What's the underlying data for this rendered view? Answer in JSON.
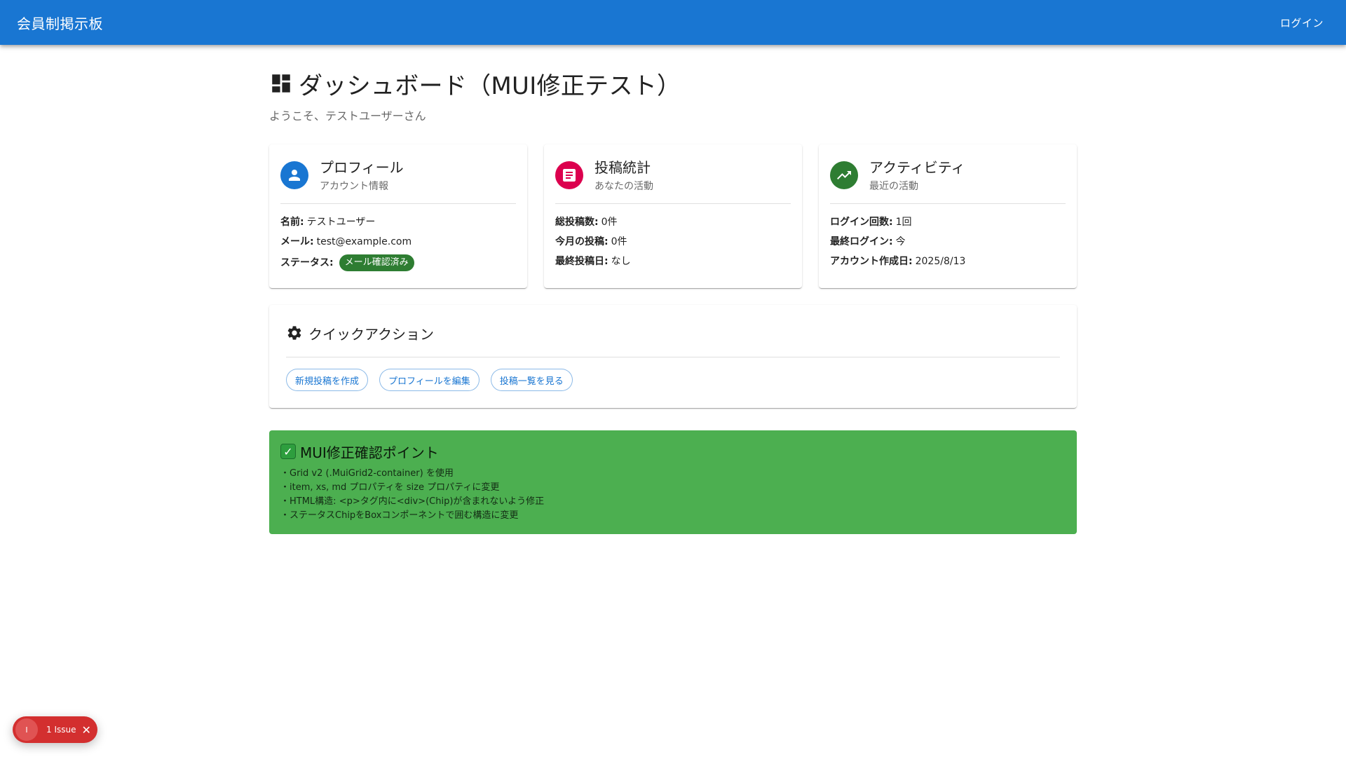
{
  "app": {
    "title": "会員制掲示板",
    "login_label": "ログイン"
  },
  "page": {
    "title": "ダッシュボード（MUI修正テスト）",
    "welcome": "ようこそ、テストユーザーさん"
  },
  "profile": {
    "title": "プロフィール",
    "subtitle": "アカウント情報",
    "name_label": "名前:",
    "name_value": "テストユーザー",
    "email_label": "メール:",
    "email_value": "test@example.com",
    "status_label": "ステータス:",
    "status_chip": "メール確認済み"
  },
  "stats": {
    "title": "投稿統計",
    "subtitle": "あなたの活動",
    "total_label": "総投稿数:",
    "total_value": "0件",
    "month_label": "今月の投稿:",
    "month_value": "0件",
    "last_label": "最終投稿日:",
    "last_value": "なし"
  },
  "activity": {
    "title": "アクティビティ",
    "subtitle": "最近の活動",
    "login_count_label": "ログイン回数:",
    "login_count_value": "1回",
    "last_login_label": "最終ログイン:",
    "last_login_value": "今",
    "created_label": "アカウント作成日:",
    "created_value": "2025/8/13"
  },
  "quick_actions": {
    "title": "クイックアクション",
    "buttons": [
      "新規投稿を作成",
      "プロフィールを編集",
      "投稿一覧を見る"
    ]
  },
  "notice": {
    "title": "MUI修正確認ポイント",
    "items": [
      "・Grid v2 (.MuiGrid2-container) を使用",
      "・item, xs, md プロパティを size プロパティに変更",
      "・HTML構造: <p>タグ内に<div>(Chip)が含まれないよう修正",
      "・ステータスChipをBoxコンポーネントで囲む構造に変更"
    ]
  },
  "issue_badge": {
    "letter": "I",
    "label": "1 Issue",
    "close": "✕"
  },
  "colors": {
    "primary": "#1976d2",
    "profile_avatar": "#1976d2",
    "stats_avatar": "#dc004e",
    "activity_avatar": "#2e7d32",
    "chip": "#2e7d32",
    "notice_bg": "#4caf50",
    "issue_bg": "#d32f2f"
  }
}
